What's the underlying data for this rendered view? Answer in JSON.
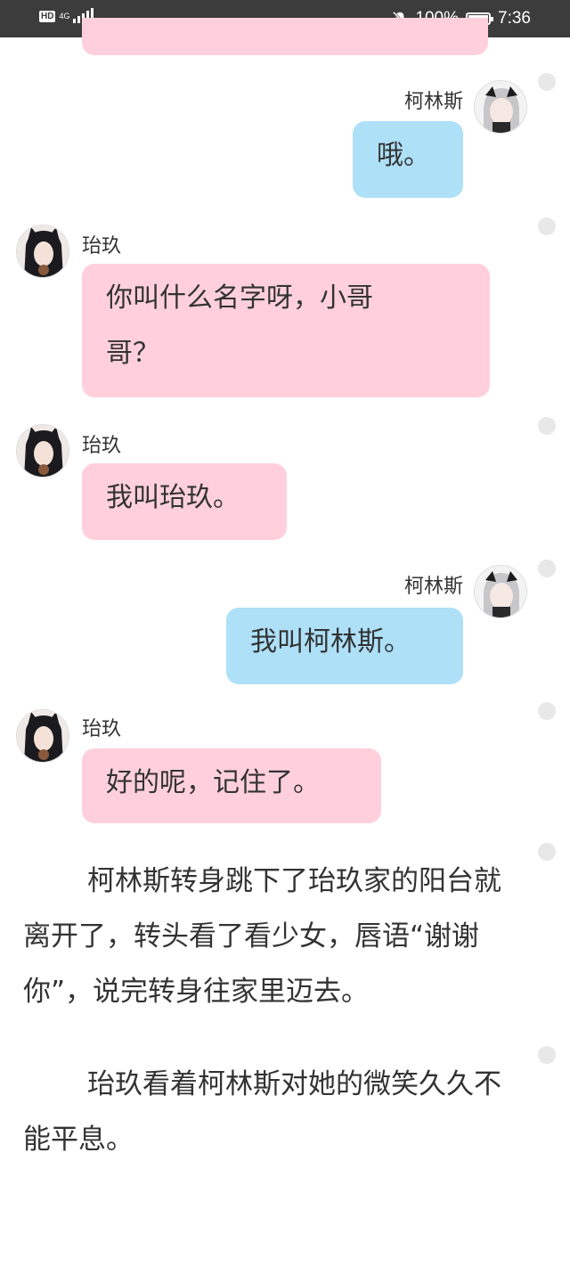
{
  "status_bar": {
    "hd": "HD",
    "network": "4G",
    "battery_level": 1.0,
    "battery_text": "100%",
    "time": "7:36"
  },
  "messages": [
    {
      "sender": "柯林斯",
      "text": "哦。",
      "side": "right"
    },
    {
      "sender": "珆玖",
      "text": "你叫什么名字呀，小哥哥？",
      "line1": "你叫什么名字呀，小哥",
      "line2": "哥？",
      "side": "left"
    },
    {
      "sender": "珆玖",
      "text": "我叫珆玖。",
      "side": "left"
    },
    {
      "sender": "柯林斯",
      "text": "我叫柯林斯。",
      "side": "right"
    },
    {
      "sender": "珆玖",
      "text": "好的呢，记住了。",
      "side": "left"
    }
  ],
  "narration": [
    "柯林斯转身跳下了珆玖家的阳台就离开了，转头看了看少女，唇语“谢谢你”，说完转身往家里迈去。",
    "珆玖看着柯林斯对她的微笑久久不能平息。"
  ],
  "colors": {
    "left_bubble": "#ffd0dc",
    "right_bubble": "#aee0f8",
    "status_bar": "#3c3c3c"
  }
}
